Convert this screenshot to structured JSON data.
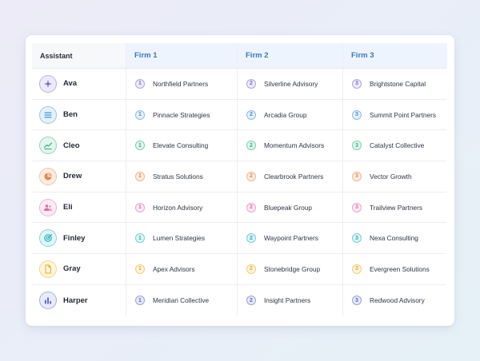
{
  "header": {
    "assistant": "Assistant",
    "firm1": "Firm 1",
    "firm2": "Firm 2",
    "firm3": "Firm 3"
  },
  "rows": [
    {
      "name": "Ava",
      "icon": "sparkle-icon",
      "color": "#7c6ad8",
      "bg": "#ecebfb",
      "firms": [
        "Northfield Partners",
        "Silverline Advisory",
        "Brightstone Capital"
      ],
      "ranks": [
        "1",
        "2",
        "3"
      ]
    },
    {
      "name": "Ben",
      "icon": "list-icon",
      "color": "#3f8fd9",
      "bg": "#e5f1fc",
      "firms": [
        "Pinnacle Strategies",
        "Arcadia Group",
        "Summit Point Partners"
      ],
      "ranks": [
        "1",
        "2",
        "3"
      ]
    },
    {
      "name": "Cleo",
      "icon": "trend-chart-icon",
      "color": "#2fae79",
      "bg": "#e3f6ee",
      "firms": [
        "Elevate Consulting",
        "Momentum Advisors",
        "Catalyst Collective"
      ],
      "ranks": [
        "1",
        "2",
        "3"
      ]
    },
    {
      "name": "Drew",
      "icon": "pie-chart-icon",
      "color": "#e8844f",
      "bg": "#fdeee5",
      "firms": [
        "Stratus Solutions",
        "Clearbrook Partners",
        "Vector Growth"
      ],
      "ranks": [
        "1",
        "2",
        "3"
      ]
    },
    {
      "name": "Eli",
      "icon": "people-icon",
      "color": "#dc6ea6",
      "bg": "#fcebf4",
      "firms": [
        "Horizon Advisory",
        "Bluepeak Group",
        "Trailview Partners"
      ],
      "ranks": [
        "1",
        "2",
        "3"
      ]
    },
    {
      "name": "Finley",
      "icon": "target-icon",
      "color": "#22aeb4",
      "bg": "#e1f6f7",
      "firms": [
        "Lumen Strategies",
        "Waypoint Partners",
        "Nexa Consulting"
      ],
      "ranks": [
        "1",
        "2",
        "3"
      ]
    },
    {
      "name": "Gray",
      "icon": "document-icon",
      "color": "#e0ad2a",
      "bg": "#fdf5dc",
      "firms": [
        "Apex Advisors",
        "Stonebridge Group",
        "Evergreen Solutions"
      ],
      "ranks": [
        "1",
        "2",
        "3"
      ]
    },
    {
      "name": "Harper",
      "icon": "bar-chart-icon",
      "color": "#5a63c9",
      "bg": "#e9eafa",
      "firms": [
        "Meridian Collective",
        "Insight Partners",
        "Redwood Advisory"
      ],
      "ranks": [
        "1",
        "2",
        "3"
      ]
    }
  ]
}
